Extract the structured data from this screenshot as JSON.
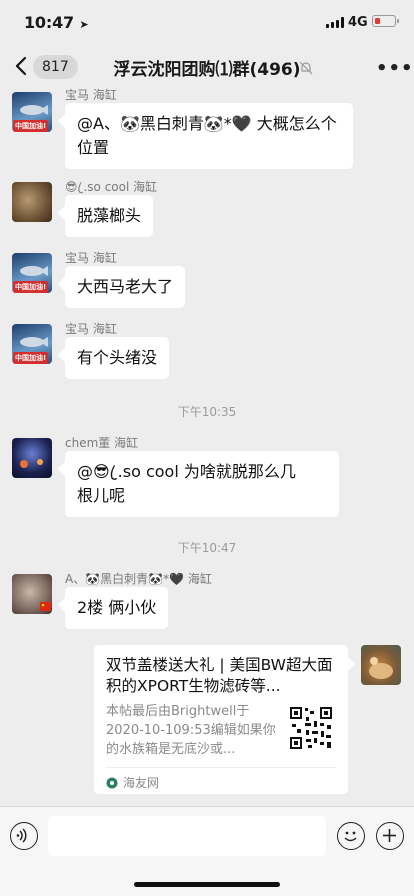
{
  "status": {
    "time": "10:47",
    "network": "4G"
  },
  "nav": {
    "unread_count": "817",
    "title": "浮云沈阳团购⑴群(496)"
  },
  "messages": [
    {
      "sender": "宝马 海缸",
      "text": "@A、🐼黑白刺青🐼*🖤 大概怎么个位置",
      "avatar_tag": "中国加油!"
    },
    {
      "sender": "😎 ꦿ.so cool 海缸",
      "text": "脱藻榔头"
    },
    {
      "sender": "宝马 海缸",
      "text": "大西马老大了",
      "avatar_tag": "中国加油!"
    },
    {
      "sender": "宝马 海缸",
      "text": "有个头绪没",
      "avatar_tag": "中国加油!"
    },
    {
      "sender": "chem董 海缸",
      "text_line1": "@😎 ꦿ.so cool 为啥就脱那么几",
      "text_line2": "根儿呢"
    },
    {
      "sender": "A、🐼黑白刺青🐼*🖤 海缸",
      "text": "2楼 俩小伙"
    }
  ],
  "timestamps": [
    "下午10:35",
    "下午10:47"
  ],
  "link_card": {
    "title": "双节盖楼送大礼 | 美国BW超大面积的XPORT生物滤砖等...",
    "description": "本帖最后由Brightwell于2020-10-109:53编辑如果你的水族箱是无底沙或...",
    "source": "海友网"
  },
  "colors": {
    "background": "#ededed",
    "bubble": "#ffffff",
    "battery_low": "#e53935"
  }
}
